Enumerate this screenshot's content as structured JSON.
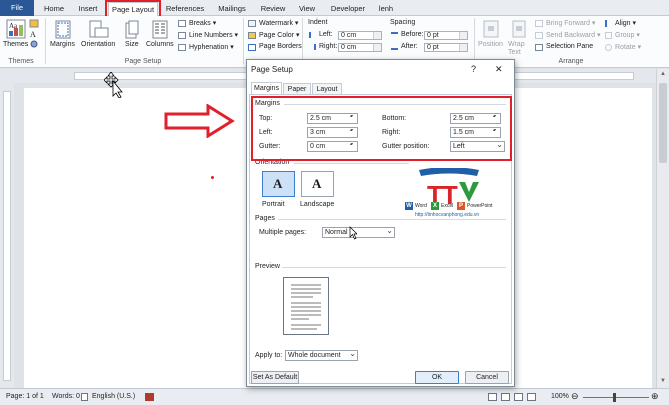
{
  "ribbon_tabs": [
    "File",
    "Home",
    "Insert",
    "Page Layout",
    "References",
    "Mailings",
    "Review",
    "View",
    "Developer",
    "lenh"
  ],
  "themes": {
    "button": "Themes",
    "group": "Themes"
  },
  "page_setup": {
    "margins": "Margins",
    "orientation": "Orientation",
    "size": "Size",
    "columns": "Columns",
    "breaks": "Breaks ▾",
    "line_numbers": "Line Numbers ▾",
    "hyphenation": "Hyphenation ▾",
    "group": "Page Setup"
  },
  "page_background": {
    "watermark": "Watermark ▾",
    "page_color": "Page Color ▾",
    "page_borders": "Page Borders"
  },
  "paragraph": {
    "indent_title": "Indent",
    "left_label": "Left:",
    "left_value": "0 cm",
    "right_label": "Right:",
    "right_value": "0 cm",
    "spacing_title": "Spacing",
    "before_label": "Before:",
    "before_value": "0 pt",
    "after_label": "After:",
    "after_value": "0 pt"
  },
  "arrange": {
    "position": "Position",
    "wrap_text": "Wrap Text",
    "bring_forward": "Bring Forward ▾",
    "send_backward": "Send Backward ▾",
    "selection_pane": "Selection Pane",
    "align": "Align ▾",
    "group": "Group ▾",
    "rotate": "Rotate ▾",
    "group_label": "Arrange"
  },
  "dialog": {
    "title": "Page Setup",
    "help": "?",
    "close": "✕",
    "tabs": [
      "Margins",
      "Paper",
      "Layout"
    ],
    "margins_section": "Margins",
    "top_label": "Top:",
    "top_value": "2.5 cm",
    "bottom_label": "Bottom:",
    "bottom_value": "2.5 cm",
    "left_label": "Left:",
    "left_value": "3 cm",
    "right_label": "Right:",
    "right_value": "1.5 cm",
    "gutter_label": "Gutter:",
    "gutter_value": "0 cm",
    "gutter_pos_label": "Gutter position:",
    "gutter_pos_value": "Left",
    "orientation_section": "Orientation",
    "portrait": "Portrait",
    "landscape": "Landscape",
    "pages_section": "Pages",
    "multiple_pages_label": "Multiple pages:",
    "multiple_pages_value": "Normal",
    "preview_section": "Preview",
    "apply_to_label": "Apply to:",
    "apply_to_value": "Whole document",
    "set_default": "Set As Default",
    "ok": "OK",
    "cancel": "Cancel"
  },
  "logo": {
    "brand": "TTV",
    "word": "Word",
    "excel": "Excel",
    "powerpoint": "PowerPoint",
    "url": "http://tinhocvanphong.edu.vn"
  },
  "status": {
    "page": "Page: 1 of 1",
    "words": "Words: 0",
    "language": "English (U.S.)",
    "zoom": "100%"
  },
  "colors": {
    "accent_red": "#e0202a",
    "file_tab": "#2b5797",
    "logo_red": "#d9252a",
    "logo_green": "#2e9a3e",
    "logo_blue": "#1f5fa8"
  }
}
